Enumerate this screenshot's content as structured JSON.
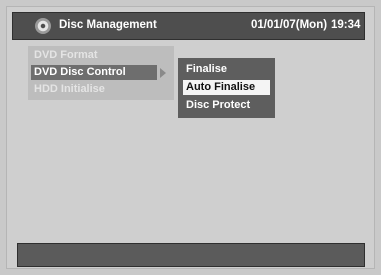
{
  "header": {
    "title": "Disc Management",
    "date": "01/01/07(Mon)",
    "time": "19:34",
    "icon": "disc-icon"
  },
  "menu": {
    "items": [
      {
        "label": "DVD Format",
        "state": "disabled"
      },
      {
        "label": "DVD Disc Control",
        "state": "selected"
      },
      {
        "label": "HDD Initialise",
        "state": "disabled"
      }
    ]
  },
  "submenu": {
    "items": [
      {
        "label": "Finalise",
        "state": "normal"
      },
      {
        "label": "Auto Finalise",
        "state": "highlighted"
      },
      {
        "label": "Disc Protect",
        "state": "normal"
      }
    ]
  },
  "colors": {
    "background": "#c9c9c9",
    "header_bar": "#4e4e4e",
    "submenu_bg": "#5e5e5e",
    "highlight": "#f4f4f4"
  }
}
